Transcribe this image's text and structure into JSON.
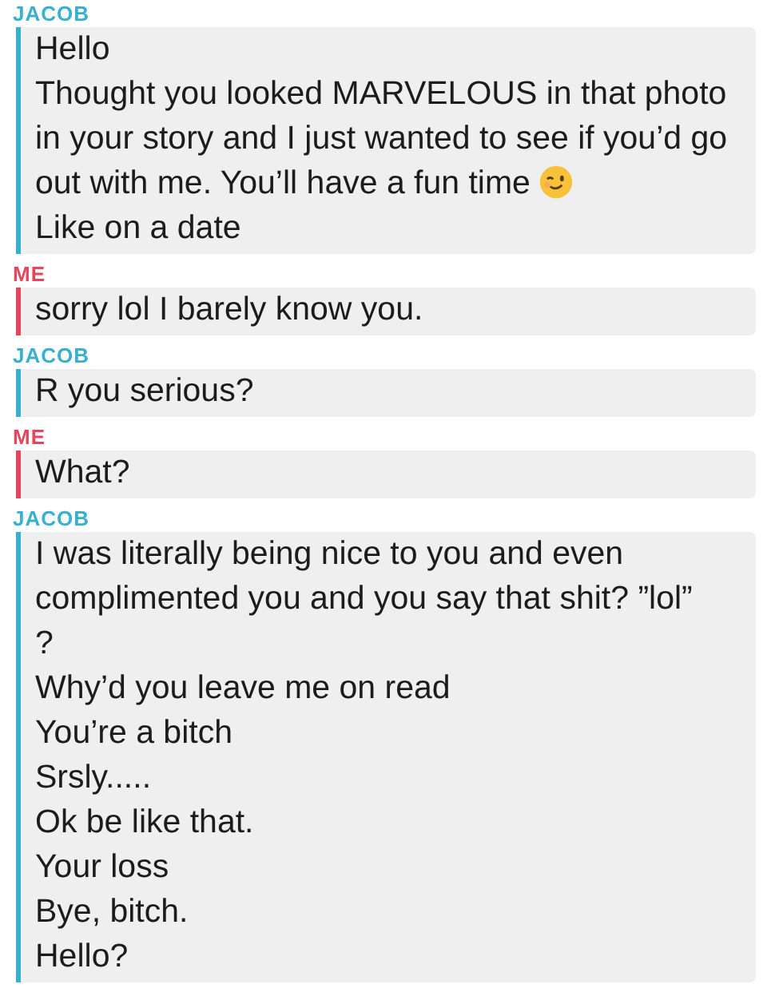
{
  "conversation": [
    {
      "sender": "JACOB",
      "color": "#3ab0d0",
      "messages": [
        {
          "text": "Hello"
        },
        {
          "text": "Thought you looked MARVELOUS in that photo in your story and I just wanted to see if you’d go out with me. You’ll have a fun time",
          "emoji": true
        },
        {
          "text": "Like on a date"
        }
      ]
    },
    {
      "sender": "ME",
      "color": "#e2475e",
      "messages": [
        {
          "text": "sorry lol I barely know you."
        }
      ]
    },
    {
      "sender": "JACOB",
      "color": "#3ab0d0",
      "messages": [
        {
          "text": "R you serious?"
        }
      ]
    },
    {
      "sender": "ME",
      "color": "#e2475e",
      "messages": [
        {
          "text": "What?"
        }
      ]
    },
    {
      "sender": "JACOB",
      "color": "#3ab0d0",
      "messages": [
        {
          "text": "I was literally being nice to you and even complimented you and you say that shit? ”lol”"
        },
        {
          "text": "?"
        },
        {
          "text": "Why’d you leave me on read"
        },
        {
          "text": "You’re a bitch"
        },
        {
          "text": "Srsly....."
        },
        {
          "text": "Ok be like that."
        },
        {
          "text": "Your loss"
        },
        {
          "text": "Bye, bitch."
        },
        {
          "text": "Hello?"
        }
      ]
    }
  ]
}
